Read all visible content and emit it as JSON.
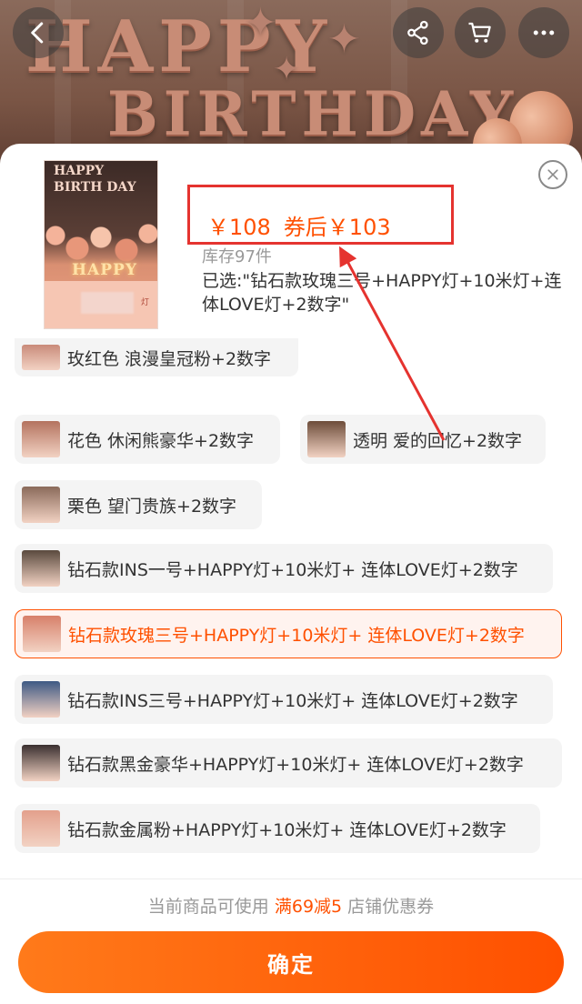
{
  "background": {
    "banner_line1": "HAPPY",
    "banner_line2": "BIRTHDAY"
  },
  "topbar": {
    "back_icon": "chevron-left-icon",
    "share_icon": "share-icon",
    "cart_icon": "cart-icon",
    "more_icon": "more-dots-icon"
  },
  "product": {
    "thumb_title_1": "HAPPY",
    "thumb_title_2": "BIRTH DAY",
    "thumb_happy": "HAPPY",
    "thumb_tag": "灯",
    "price": "￥108",
    "coupon_price": "券后￥103",
    "stock": "库存97件",
    "selected": "已选:\"钻石款玫瑰三号+HAPPY灯+10米灯+连体LOVE灯+2数字\""
  },
  "options": [
    {
      "label": "玫红色 浪漫皇冠粉+2数字",
      "color": "#c98b7a"
    },
    {
      "label": "花色 休闲熊豪华+2数字",
      "color": "#b4735f"
    },
    {
      "label": "透明 爱的回忆+2数字",
      "color": "#6d4d3a"
    },
    {
      "label": "栗色 望门贵族+2数字",
      "color": "#8a6a5a"
    },
    {
      "label": "钻石款INS一号+HAPPY灯+10米灯+ 连体LOVE灯+2数字",
      "color": "#5a4a3e"
    },
    {
      "label": "钻石款玫瑰三号+HAPPY灯+10米灯+ 连体LOVE灯+2数字",
      "color": "#d7806a",
      "selected": true
    },
    {
      "label": "钻石款INS三号+HAPPY灯+10米灯+ 连体LOVE灯+2数字",
      "color": "#3e5a84"
    },
    {
      "label": "钻石款黑金豪华+HAPPY灯+10米灯+ 连体LOVE灯+2数字",
      "color": "#3a3030"
    },
    {
      "label": "钻石款金属粉+HAPPY灯+10米灯+ 连体LOVE灯+2数字",
      "color": "#e3a08c"
    }
  ],
  "coupon": {
    "prefix": "当前商品可使用",
    "highlight": "满69减5",
    "suffix": "店铺优惠券"
  },
  "confirm_label": "确定",
  "accent_color": "#ff5000",
  "annotation_color": "#e5332f"
}
